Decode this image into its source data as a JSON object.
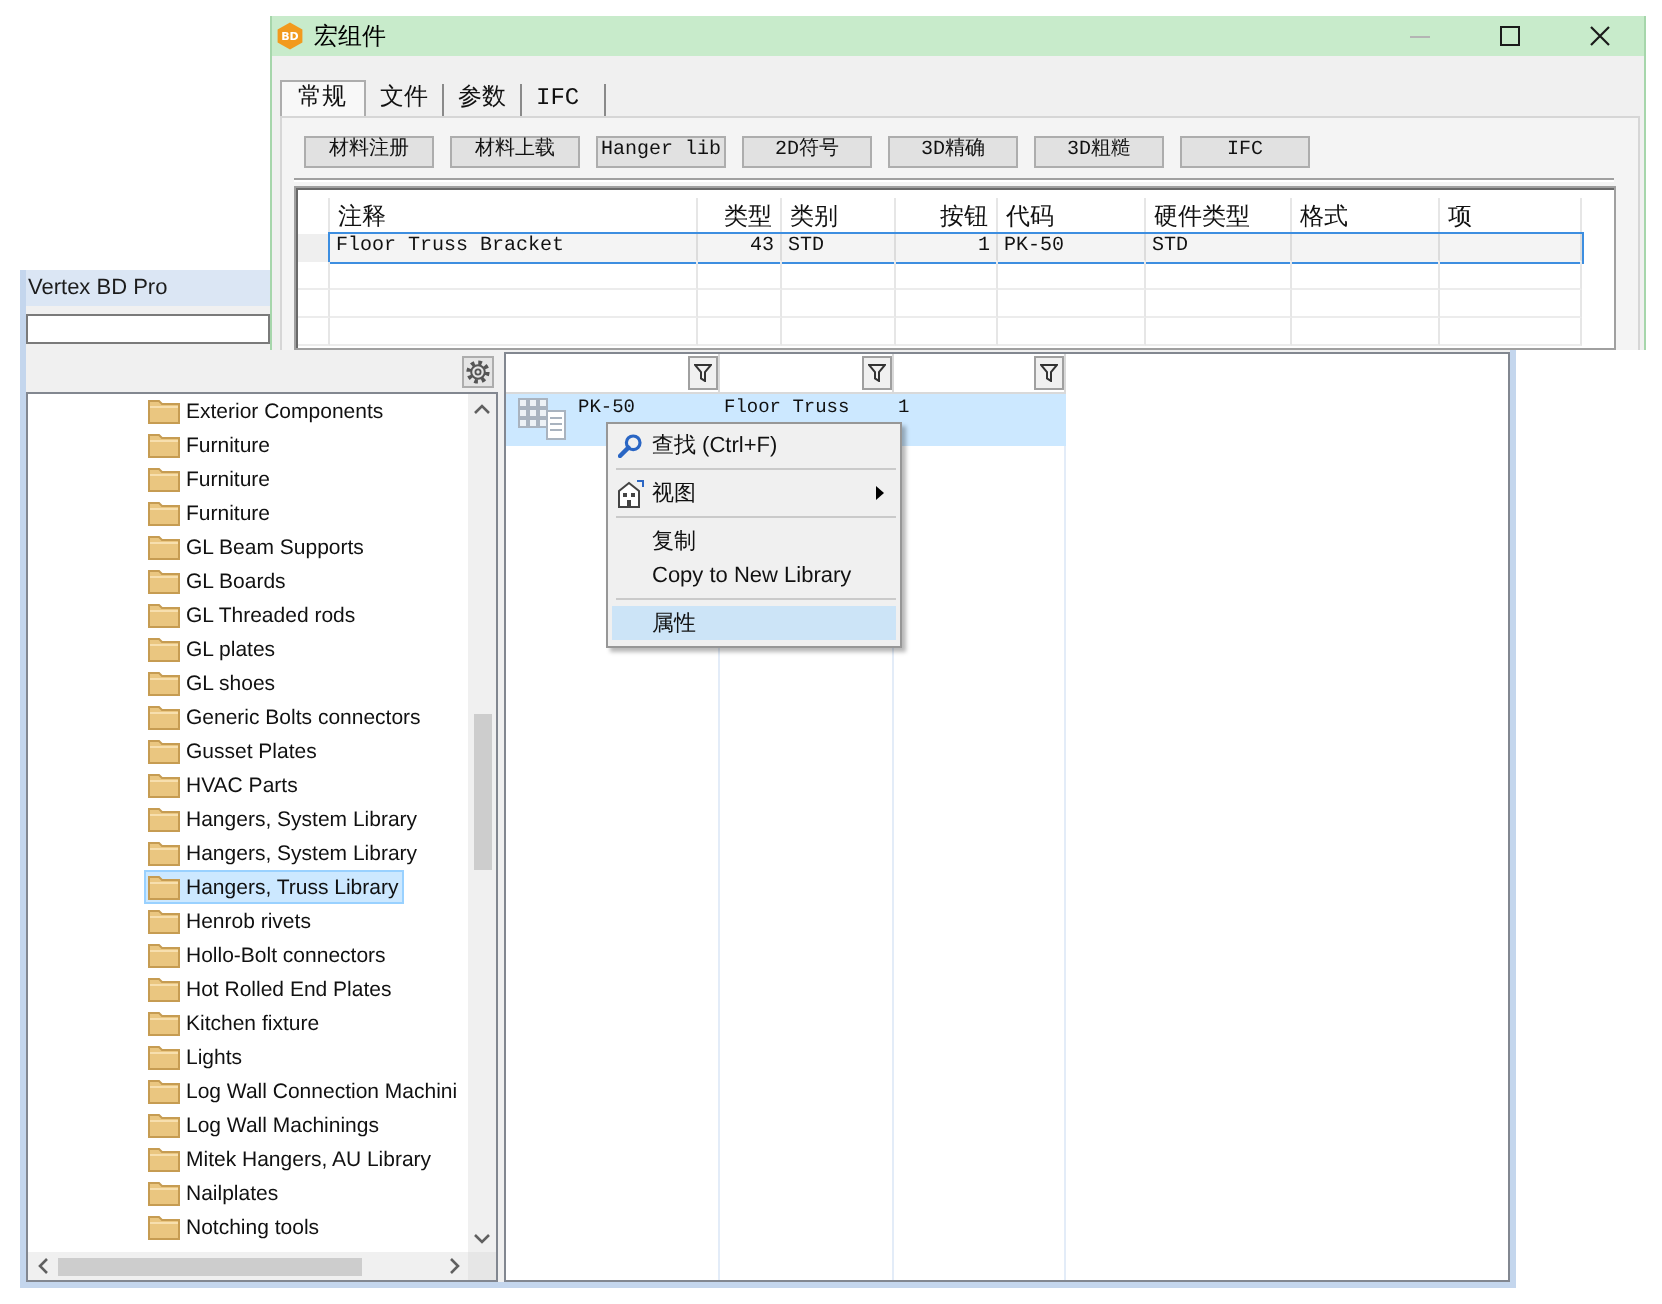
{
  "dialog": {
    "title": "宏组件",
    "logo_text": "BD",
    "controls": [
      {
        "kind": "minimize",
        "disabled": true
      },
      {
        "kind": "maximize",
        "disabled": false
      },
      {
        "kind": "close",
        "disabled": false
      }
    ],
    "tabs": [
      {
        "label": "常规",
        "selected": true
      },
      {
        "label": "文件",
        "selected": false
      },
      {
        "label": "参数",
        "selected": false
      },
      {
        "label": "IFC",
        "selected": false
      }
    ],
    "buttons": [
      "材料注册",
      "材料上载",
      "Hanger lib",
      "2D符号",
      "3D精确",
      "3D粗糙",
      "IFC"
    ],
    "table": {
      "columns": [
        {
          "label": "注释",
          "kind": "text"
        },
        {
          "label": "类型",
          "kind": "number"
        },
        {
          "label": "类别",
          "kind": "text"
        },
        {
          "label": "按钮",
          "kind": "number"
        },
        {
          "label": "代码",
          "kind": "text"
        },
        {
          "label": "硬件类型",
          "kind": "text"
        },
        {
          "label": "格式",
          "kind": "text"
        },
        {
          "label": "项",
          "kind": "text"
        }
      ],
      "rows": [
        {
          "selected": true,
          "cells": [
            "Floor Truss Bracket",
            "43",
            "STD",
            "1",
            "PK-50",
            "STD"
          ]
        }
      ]
    }
  },
  "main_window": {
    "title": "Vertex BD Pro",
    "tree": {
      "items": [
        {
          "label": "Exterior Components",
          "selected": false
        },
        {
          "label": "Furniture",
          "selected": false
        },
        {
          "label": "Furniture",
          "selected": false
        },
        {
          "label": "Furniture",
          "selected": false
        },
        {
          "label": "GL Beam Supports",
          "selected": false
        },
        {
          "label": "GL Boards",
          "selected": false
        },
        {
          "label": "GL Threaded rods",
          "selected": false
        },
        {
          "label": "GL plates",
          "selected": false
        },
        {
          "label": "GL shoes",
          "selected": false
        },
        {
          "label": "Generic Bolts connectors",
          "selected": false
        },
        {
          "label": "Gusset Plates",
          "selected": false
        },
        {
          "label": "HVAC Parts",
          "selected": false
        },
        {
          "label": "Hangers, System Library",
          "selected": false
        },
        {
          "label": "Hangers, System Library",
          "selected": false
        },
        {
          "label": "Hangers, Truss Library",
          "selected": true
        },
        {
          "label": "Henrob rivets",
          "selected": false
        },
        {
          "label": "Hollo-Bolt connectors",
          "selected": false
        },
        {
          "label": "Hot Rolled End Plates",
          "selected": false
        },
        {
          "label": "Kitchen fixture",
          "selected": false
        },
        {
          "label": "Lights",
          "selected": false
        },
        {
          "label": "Log Wall Connection Machini",
          "selected": false
        },
        {
          "label": "Log Wall Machinings",
          "selected": false
        },
        {
          "label": "Mitek Hangers, AU Library",
          "selected": false
        },
        {
          "label": "Nailplates",
          "selected": false
        },
        {
          "label": "Notching tools",
          "selected": false
        }
      ]
    },
    "grid": {
      "columns": [
        {
          "filter": true
        },
        {
          "filter": true
        },
        {
          "filter": true
        }
      ],
      "rows": [
        {
          "selected": true,
          "cells": [
            "PK-50",
            "Floor Truss",
            "1"
          ]
        }
      ]
    }
  },
  "context_menu": {
    "items": [
      {
        "kind": "search",
        "label": "查找 (Ctrl+F)",
        "selected": false
      },
      {
        "kind": "separator"
      },
      {
        "kind": "submenu",
        "label": "视图",
        "selected": false
      },
      {
        "kind": "separator"
      },
      {
        "kind": "plain",
        "label": "复制",
        "selected": false
      },
      {
        "kind": "plain",
        "label": "Copy to New Library",
        "selected": false
      },
      {
        "kind": "separator"
      },
      {
        "kind": "plain",
        "label": "属性",
        "selected": true
      }
    ]
  }
}
